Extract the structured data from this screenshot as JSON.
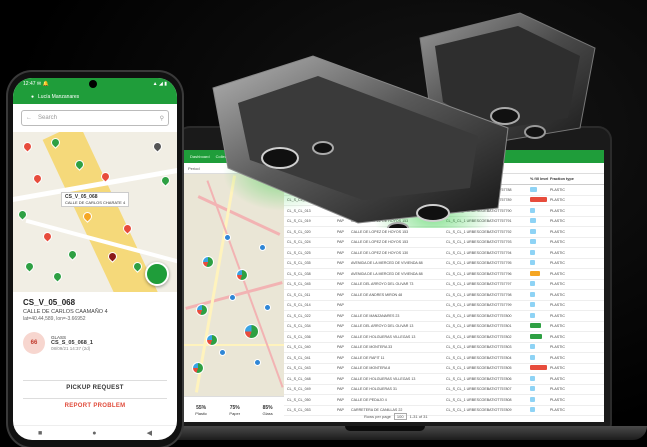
{
  "phone": {
    "status_time": "12:47 ✉ 🔔",
    "status_right": "▲ ◢ ▮",
    "user_name": "Lucía Manzanares",
    "search_placeholder": "Search",
    "map_label_code": "CS_V_05_068",
    "map_label_address": "CALLE DE CARLOS CHARATE 4",
    "detail_code": "CS_V_05_068",
    "detail_address": "CALLE DE CARLOS CAAMAÑO 4",
    "detail_coords": "lat=40.44,589, lon=-3.66952",
    "bin_fill": "66",
    "bin_level_label": "GLASS",
    "bin_code": "CS_S_05_068_1",
    "bin_updated": "08/09/21 14:37 (2d)",
    "pickup_label": "PICKUP REQUEST",
    "report_label": "REPORT PROBLEM",
    "nav_back": "◀",
    "nav_home": "●",
    "nav_recent": "■"
  },
  "laptop": {
    "tabs": [
      "Dashboard",
      "Collections",
      "Alerts"
    ],
    "filter_text": "Period",
    "columns": [
      "Search",
      "",
      "Address",
      "Container ID",
      "% fill level",
      "Fraction type",
      ""
    ],
    "rows": [
      {
        "id": "CL_S_CL_011",
        "n": "PAP",
        "addr": "CALLE DE LOPEZ DE HOYOS 51",
        "cid": "CL_S_CL_1 URBESCOEBATIOT757788",
        "fill": 0.38,
        "color": "#8ed3f5",
        "type": "PLASTIC"
      },
      {
        "id": "CL_S_CL_012",
        "n": "PAP",
        "addr": "CALLE DE LOPEZ DE HOYOS 51",
        "cid": "CL_S_CL_1 URBESCOEBATIOT757789",
        "fill": 0.92,
        "color": "#e74c3c",
        "type": "PLASTIC"
      },
      {
        "id": "CL_S_CL_013",
        "n": "PAP",
        "addr": "CALLE DE LOPEZ DE HOYOS 49",
        "cid": "CL_S_CL_1 URBESCOEBATIOT757790",
        "fill": 0.3,
        "color": "#8ed3f5",
        "type": "PLASTIC"
      },
      {
        "id": "CL_S_CL_019",
        "n": "PAP",
        "addr": "CALLE DE LOPEZ DE HOYOS 153",
        "cid": "CL_S_CL_1 URBESCOEBATIOT757791",
        "fill": 0.35,
        "color": "#8ed3f5",
        "type": "PLASTIC"
      },
      {
        "id": "CL_S_CL_020",
        "n": "PAP",
        "addr": "CALLE DE LOPEZ DE HOYOS 153",
        "cid": "CL_S_CL_1 URBESCOEBATIOT757792",
        "fill": 0.33,
        "color": "#8ed3f5",
        "type": "PLASTIC"
      },
      {
        "id": "CL_S_CL_024",
        "n": "PAP",
        "addr": "CALLE DE LOPEZ DE HOYOS 153",
        "cid": "CL_S_CL_1 URBESCOEBATIOT757793",
        "fill": 0.31,
        "color": "#8ed3f5",
        "type": "PLASTIC"
      },
      {
        "id": "CL_S_CL_025",
        "n": "PAP",
        "addr": "CALLE DE LOPEZ DE HOYOS 130",
        "cid": "CL_S_CL_1 URBESCOEBATIOT757794",
        "fill": 0.28,
        "color": "#8ed3f5",
        "type": "PLASTIC"
      },
      {
        "id": "CL_S_CL_035",
        "n": "PAP",
        "addr": "AVENIDA DE LA MERCED DE VIVIENDA 88",
        "cid": "CL_S_CL_1 URBESCOEBATIOT757795",
        "fill": 0.25,
        "color": "#8ed3f5",
        "type": "PLASTIC"
      },
      {
        "id": "CL_S_CL_038",
        "n": "PAP",
        "addr": "AVENIDA DE LA MERCED DE VIVIENDA 88",
        "cid": "CL_S_CL_1 URBESCOEBATIOT757796",
        "fill": 0.55,
        "color": "#f5a623",
        "type": "PLASTIC"
      },
      {
        "id": "CL_S_CL_045",
        "n": "PAP",
        "addr": "CALLE DEL ARROYO DEL OLIVAR 73",
        "cid": "CL_S_CL_1 URBESCOEBATIOT757797",
        "fill": 0.3,
        "color": "#8ed3f5",
        "type": "PLASTIC"
      },
      {
        "id": "CL_S_CL_011",
        "n": "PAP",
        "addr": "CALLE DE ANDRES MIRON 48",
        "cid": "CL_S_CL_1 URBESCOEBATIOT757798",
        "fill": 0.3,
        "color": "#8ed3f5",
        "type": "PLASTIC"
      },
      {
        "id": "CL_S_CL_014",
        "n": "PAP",
        "addr": "",
        "cid": "CL_S_CL_1 URBESCOEBATIOT757799",
        "fill": 0.29,
        "color": "#8ed3f5",
        "type": "PLASTIC"
      },
      {
        "id": "CL_S_CL_022",
        "n": "PAP",
        "addr": "CALLE DE MANZANARES 23",
        "cid": "CL_S_CL_1 URBESCOEBATIOT757800",
        "fill": 0.3,
        "color": "#8ed3f5",
        "type": "PLASTIC"
      },
      {
        "id": "CL_S_CL_034",
        "n": "PAP",
        "addr": "CALLE DEL ARROYO DEL OLIVAR 13",
        "cid": "CL_S_CL_1 URBESCOEBATIOT757801",
        "fill": 0.6,
        "color": "#2ea043",
        "type": "PLASTIC"
      },
      {
        "id": "CL_S_CL_036",
        "n": "PAP",
        "addr": "CALLE DE HOLGUERAS VILLEGAS 13",
        "cid": "CL_S_CL_1 URBESCOEBATIOT757802",
        "fill": 0.65,
        "color": "#2ea043",
        "type": "PLASTIC"
      },
      {
        "id": "CL_S_CL_040",
        "n": "PAP",
        "addr": "CALLE DE MONTERA 33",
        "cid": "CL_S_CL_1 URBESCOEBATIOT757803",
        "fill": 0.3,
        "color": "#8ed3f5",
        "type": "PLASTIC"
      },
      {
        "id": "CL_S_CL_041",
        "n": "PAP",
        "addr": "CALLE DE RAFIT 11",
        "cid": "CL_S_CL_1 URBESCOEBATIOT757804",
        "fill": 0.3,
        "color": "#8ed3f5",
        "type": "PLASTIC"
      },
      {
        "id": "CL_S_CL_043",
        "n": "PAP",
        "addr": "CALLE DE MONTERA 8",
        "cid": "CL_S_CL_1 URBESCOEBATIOT757805",
        "fill": 0.95,
        "color": "#e74c3c",
        "type": "PLASTIC"
      },
      {
        "id": "CL_S_CL_048",
        "n": "PAP",
        "addr": "CALLE DE HOLGUERAS VILLEGAS 13",
        "cid": "CL_S_CL_1 URBESCOEBATIOT757806",
        "fill": 0.3,
        "color": "#8ed3f5",
        "type": "PLASTIC"
      },
      {
        "id": "CL_S_CL_049",
        "n": "PAP",
        "addr": "CALLE DE HOLGUERAS 31",
        "cid": "CL_S_CL_1 URBESCOEBATIOT757807",
        "fill": 0.3,
        "color": "#8ed3f5",
        "type": "PLASTIC"
      },
      {
        "id": "CL_S_CL_050",
        "n": "PAP",
        "addr": "CALLE DE PEDAJO 4",
        "cid": "CL_S_CL_1 URBESCOEBATIOT757808",
        "fill": 0.3,
        "color": "#8ed3f5",
        "type": "PLASTIC"
      },
      {
        "id": "CL_S_CL_053",
        "n": "PAP",
        "addr": "CARRETERA DE CANILLAS 22",
        "cid": "CL_S_CL_1 URBESCOEBATIOT757809",
        "fill": 0.3,
        "color": "#8ed3f5",
        "type": "PLASTIC"
      }
    ],
    "stats": [
      {
        "value": "55%",
        "label": "Plastic"
      },
      {
        "value": "75%",
        "label": "Paper"
      },
      {
        "value": "85%",
        "label": "Glass"
      }
    ],
    "pagination": {
      "rows_label": "Rows per page",
      "rows_value": "100",
      "range": "1-31 of 31"
    }
  },
  "colors": {
    "brand": "#1f9d3a",
    "alert": "#e74c3c",
    "warn": "#f5a623",
    "ok": "#8ed3f5"
  }
}
